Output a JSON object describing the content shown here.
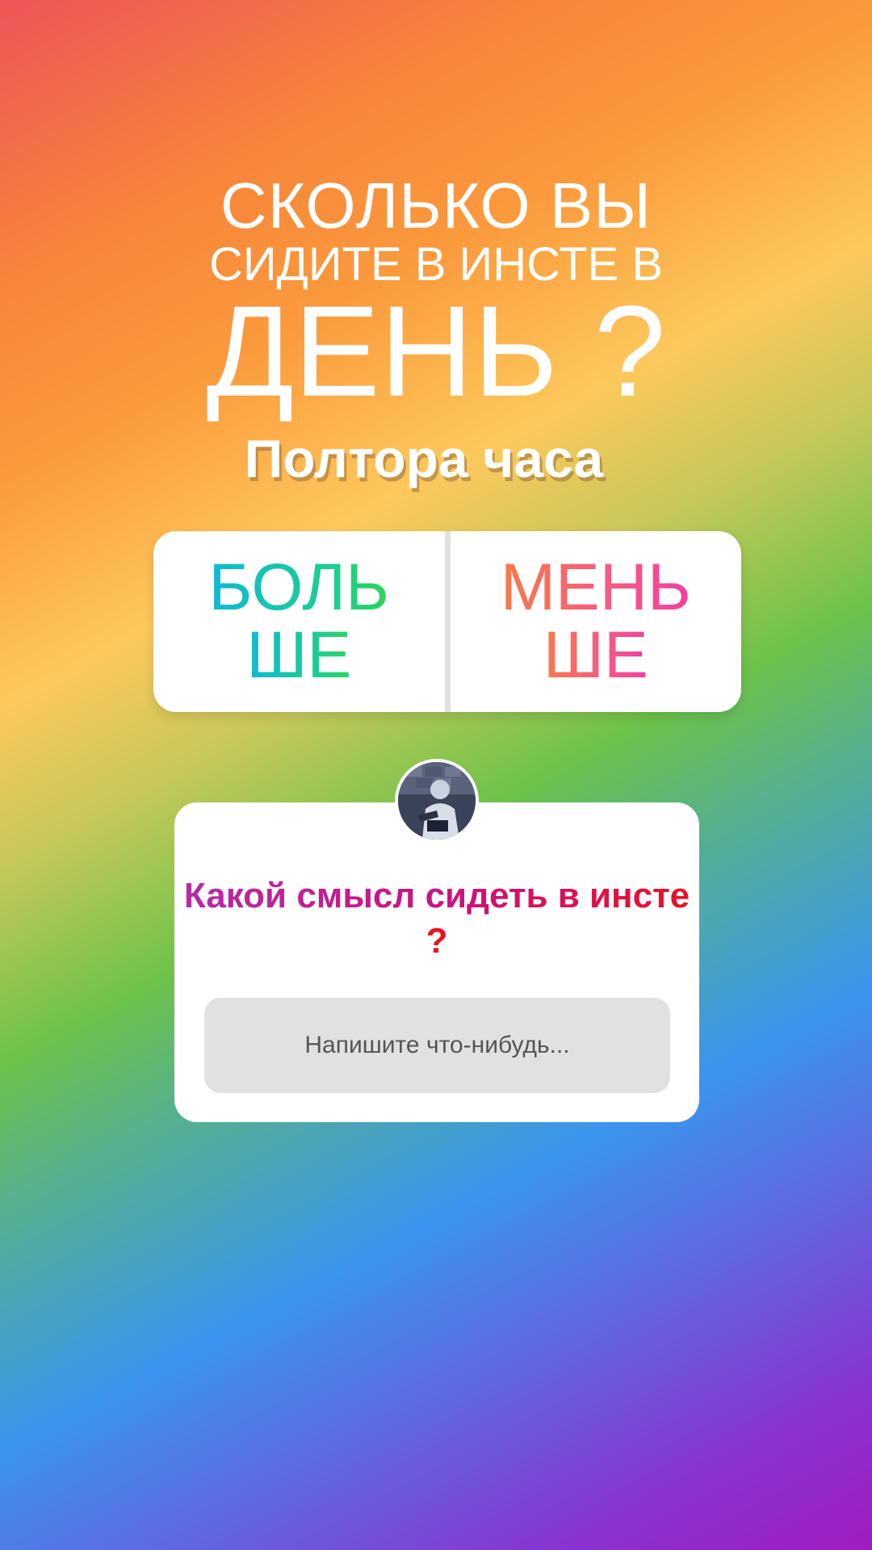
{
  "story": {
    "title_line1": "СКОЛЬКО ВЫ",
    "title_line2": "СИДИТЕ В ИНСТЕ В",
    "title_line3": "ДЕНЬ ?",
    "subtitle": "Полтора часа",
    "background_colors": [
      "#ee5358",
      "#f7843a",
      "#fdc85c",
      "#6cc24a",
      "#3a95ee",
      "#a01cc0"
    ]
  },
  "poll": {
    "option_left": {
      "line1": "БОЛЬ",
      "line2": "ШЕ"
    },
    "option_right": {
      "line1": "МЕНЬ",
      "line2": "ШЕ"
    }
  },
  "question_sticker": {
    "avatar_icon": "user-avatar",
    "question": "Какой смысл сидеть в инсте ?",
    "input_placeholder": "Напишите что-нибудь..."
  }
}
